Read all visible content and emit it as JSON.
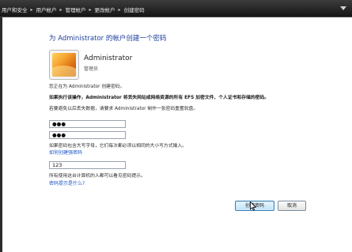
{
  "breadcrumb": {
    "items": [
      "用户和安全",
      "用户帐户",
      "管理帐户",
      "更改帐户",
      "创建密码"
    ]
  },
  "page": {
    "title": "为 Administrator 的帐户创建一个密码"
  },
  "user": {
    "name": "Administrator",
    "role": "管理员"
  },
  "info": {
    "line1": "您正在为 Administrator 创建密码。",
    "warning": "如果执行该操作，Administrator 将丢失网站或网络资源的所有 EFS 加密文件、个人证书和存储的密码。",
    "line3": "若要避免以后丢失数据，请要求 Administrator 制作一张密码重置软盘。"
  },
  "form": {
    "new_password_value": "●●●",
    "confirm_password_value": "●●●",
    "case_hint": "如果密码包含大写字母，它们每次都必须以相同的大小写方式输入。",
    "strong_password_link": "如何创建强密码",
    "hint_value": "123",
    "hint_warning": "所有使用这台计算机的人都可以看见密码提示。",
    "hint_link": "密码提示是什么?"
  },
  "buttons": {
    "create_label": "创建密码",
    "cancel_label": "取消"
  }
}
